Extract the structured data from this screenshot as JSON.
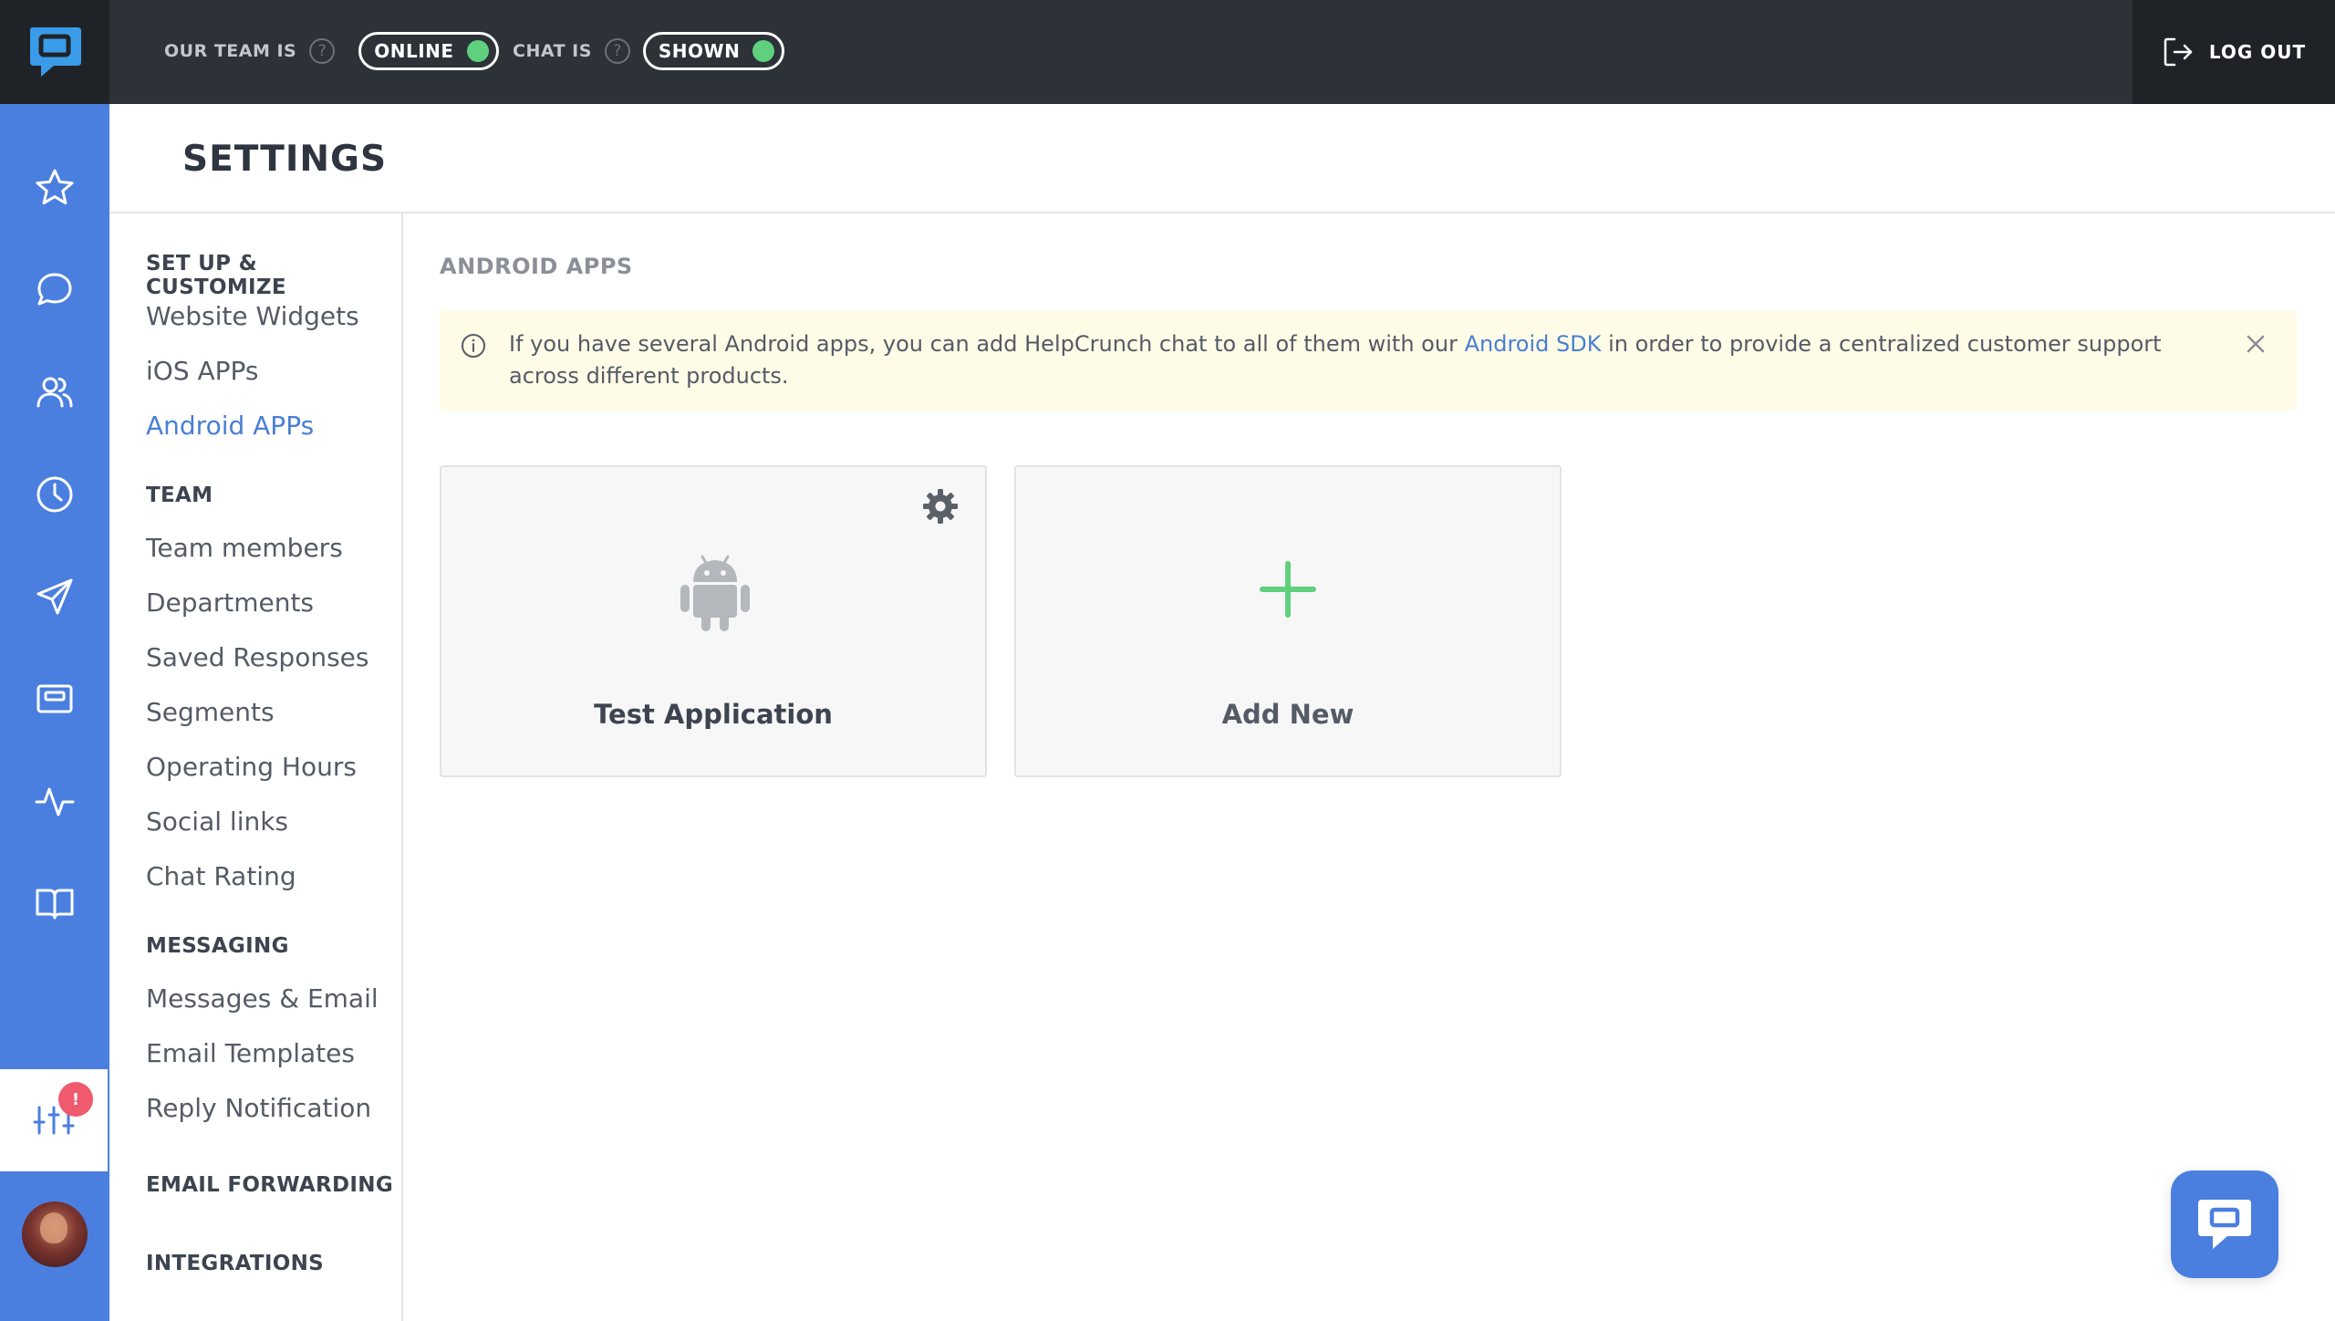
{
  "topbar": {
    "team_label": "OUR TEAM IS",
    "team_status": "ONLINE",
    "chat_label": "CHAT IS",
    "chat_status": "SHOWN",
    "logout_label": "LOG OUT",
    "status_color": "#5fd07e"
  },
  "rail": {
    "items": [
      "star-icon",
      "chat-bubble-icon",
      "users-icon",
      "clock-icon",
      "send-icon",
      "widget-icon",
      "activity-icon",
      "book-icon"
    ],
    "active_item": "sliders-icon",
    "badge": "!",
    "accent_color": "#4a7fe0"
  },
  "header": {
    "title": "SETTINGS"
  },
  "nav": {
    "setup": {
      "title": "SET UP & CUSTOMIZE",
      "items": [
        "Website Widgets",
        "iOS APPs",
        "Android APPs"
      ]
    },
    "team": {
      "title": "TEAM",
      "items": [
        "Team members",
        "Departments",
        "Saved Responses",
        "Segments",
        "Operating Hours",
        "Social links",
        "Chat Rating"
      ]
    },
    "messaging": {
      "title": "MESSAGING",
      "items": [
        "Messages & Email",
        "Email Templates",
        "Reply Notification"
      ]
    },
    "email_forwarding": "EMAIL FORWARDING",
    "integrations": "INTEGRATIONS",
    "active": "Android APPs"
  },
  "main": {
    "section_title": "ANDROID APPS",
    "notice": {
      "before": "If you have several Android apps, you can add HelpCrunch chat to all of them with our ",
      "link": "Android SDK",
      "after": " in order to provide a centralized customer support across different products."
    },
    "apps": [
      {
        "name": "Test Application",
        "icon": "android-icon"
      }
    ],
    "add_new_label": "Add New"
  }
}
